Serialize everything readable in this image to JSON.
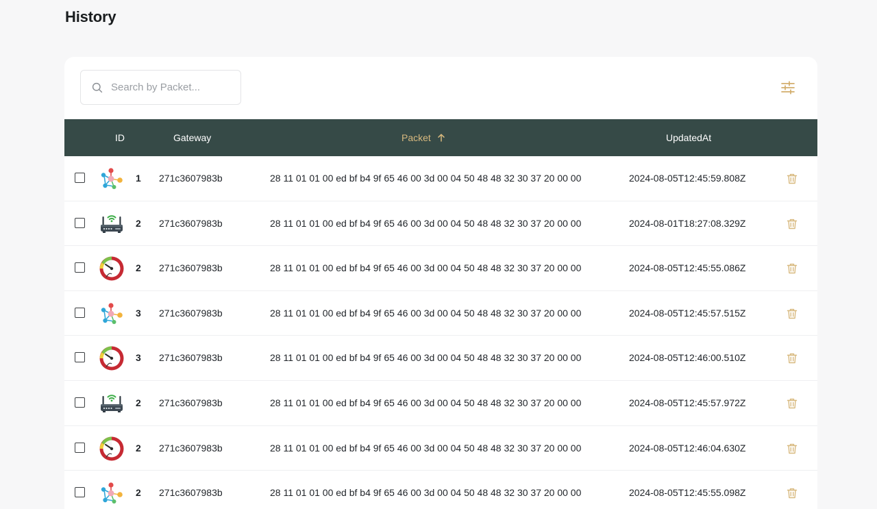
{
  "page": {
    "title": "History"
  },
  "search": {
    "placeholder": "Search by Packet..."
  },
  "table": {
    "columns": {
      "id": "ID",
      "gateway": "Gateway",
      "packet": "Packet",
      "updated": "UpdatedAt"
    },
    "sort": {
      "column": "packet",
      "direction": "asc"
    },
    "rows": [
      {
        "icon": "network-nodes-icon",
        "id": "1",
        "gateway": "271c3607983b",
        "packet": "28 11 01 01 00 ed bf b4 9f 65 46 00 3d 00 04 50 48 48 32 30 37 20 00 00",
        "updated": "2024-08-05T12:45:59.808Z"
      },
      {
        "icon": "wifi-router-icon",
        "id": "2",
        "gateway": "271c3607983b",
        "packet": "28 11 01 01 00 ed bf b4 9f 65 46 00 3d 00 04 50 48 48 32 30 37 20 00 00",
        "updated": "2024-08-01T18:27:08.329Z"
      },
      {
        "icon": "gauge-meter-icon",
        "id": "2",
        "gateway": "271c3607983b",
        "packet": "28 11 01 01 00 ed bf b4 9f 65 46 00 3d 00 04 50 48 48 32 30 37 20 00 00",
        "updated": "2024-08-05T12:45:55.086Z"
      },
      {
        "icon": "network-nodes-icon",
        "id": "3",
        "gateway": "271c3607983b",
        "packet": "28 11 01 01 00 ed bf b4 9f 65 46 00 3d 00 04 50 48 48 32 30 37 20 00 00",
        "updated": "2024-08-05T12:45:57.515Z"
      },
      {
        "icon": "gauge-meter-icon",
        "id": "3",
        "gateway": "271c3607983b",
        "packet": "28 11 01 01 00 ed bf b4 9f 65 46 00 3d 00 04 50 48 48 32 30 37 20 00 00",
        "updated": "2024-08-05T12:46:00.510Z"
      },
      {
        "icon": "wifi-router-icon",
        "id": "2",
        "gateway": "271c3607983b",
        "packet": "28 11 01 01 00 ed bf b4 9f 65 46 00 3d 00 04 50 48 48 32 30 37 20 00 00",
        "updated": "2024-08-05T12:45:57.972Z"
      },
      {
        "icon": "gauge-meter-icon",
        "id": "2",
        "gateway": "271c3607983b",
        "packet": "28 11 01 01 00 ed bf b4 9f 65 46 00 3d 00 04 50 48 48 32 30 37 20 00 00",
        "updated": "2024-08-05T12:46:04.630Z"
      },
      {
        "icon": "network-nodes-icon",
        "id": "2",
        "gateway": "271c3607983b",
        "packet": "28 11 01 01 00 ed bf b4 9f 65 46 00 3d 00 04 50 48 48 32 30 37 20 00 00",
        "updated": "2024-08-05T12:45:55.098Z"
      }
    ]
  },
  "colors": {
    "header_bg": "#364a47",
    "header_text": "#ffffff",
    "sorted_column": "#d8b97f",
    "action_icon": "#d8b97f",
    "page_bg": "#f7f7f8"
  },
  "icons": {
    "search": "search-icon",
    "filter": "sliders-icon",
    "delete": "trash-icon",
    "sort": "arrow-up-icon"
  }
}
